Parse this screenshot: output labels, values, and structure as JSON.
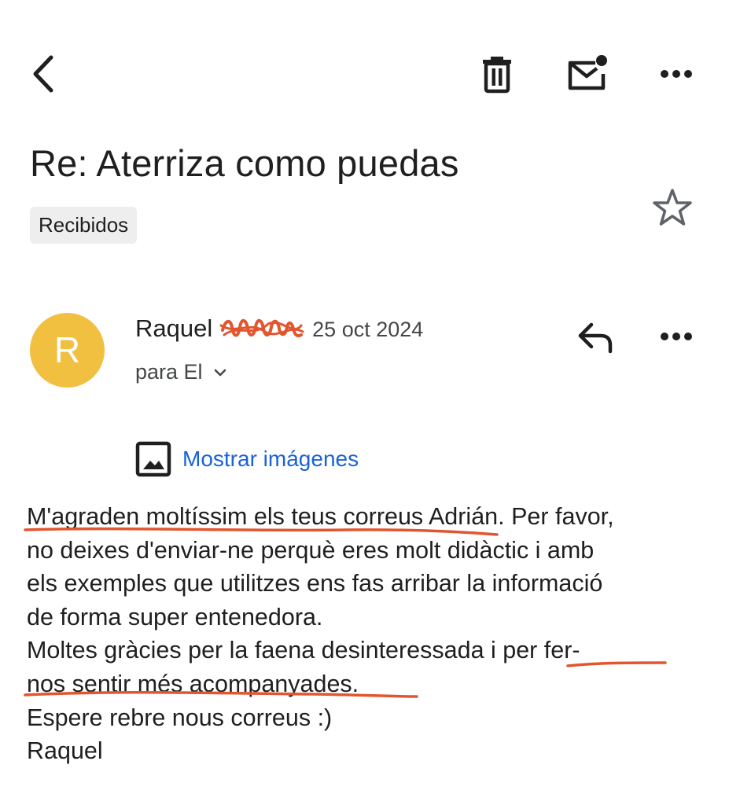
{
  "toolbar": {
    "back_icon": "chevron-left-icon",
    "delete_icon": "trash-icon",
    "mark_unread_icon": "mail-unread-icon",
    "more_icon": "more-horizontal-icon"
  },
  "email": {
    "subject": "Re: Aterriza como puedas",
    "label": "Recibidos",
    "star_icon": "star-outline-icon"
  },
  "message": {
    "avatar_letter": "R",
    "avatar_color": "#f1c040",
    "sender_name": "Raquel",
    "sender_date": "25 oct 2024",
    "recipient": "para El",
    "reply_icon": "reply-icon",
    "show_images": "Mostrar imágenes",
    "body_lines": [
      "M'agraden moltíssim els teus correus Adrián. Per favor,",
      "no deixes d'enviar-ne perquè eres molt didàctic i amb",
      "els exemples que utilitzes ens fas arribar la informació",
      "de forma super entenedora.",
      "Moltes gràcies per la faena desinteressada i per fer-",
      "nos sentir més acompanyades.",
      "Espere rebre nous correus :)",
      "Raquel"
    ]
  },
  "annotation_color": "#e2562f",
  "accent_color": "#1a62d6"
}
